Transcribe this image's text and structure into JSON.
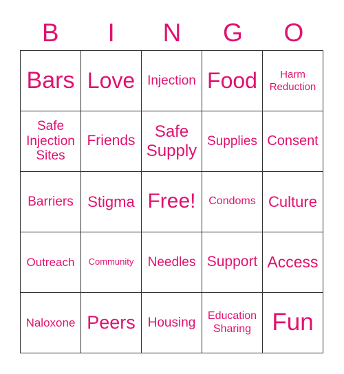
{
  "header": [
    "B",
    "I",
    "N",
    "G",
    "O"
  ],
  "accent_color": "#e0126f",
  "cells": [
    [
      {
        "text": "Bars",
        "size": 34
      },
      {
        "text": "Love",
        "size": 32
      },
      {
        "text": "Injection",
        "size": 19
      },
      {
        "text": "Food",
        "size": 32
      },
      {
        "text": "Harm Reduction",
        "size": 15
      }
    ],
    [
      {
        "text": "Safe Injection Sites",
        "size": 19
      },
      {
        "text": "Friends",
        "size": 21
      },
      {
        "text": "Safe Supply",
        "size": 24
      },
      {
        "text": "Supplies",
        "size": 19
      },
      {
        "text": "Consent",
        "size": 20
      }
    ],
    [
      {
        "text": "Barriers",
        "size": 19
      },
      {
        "text": "Stigma",
        "size": 22
      },
      {
        "text": "Free!",
        "size": 30
      },
      {
        "text": "Condoms",
        "size": 16
      },
      {
        "text": "Culture",
        "size": 22
      }
    ],
    [
      {
        "text": "Outreach",
        "size": 17
      },
      {
        "text": "Community",
        "size": 13
      },
      {
        "text": "Needles",
        "size": 19
      },
      {
        "text": "Support",
        "size": 21
      },
      {
        "text": "Access",
        "size": 23
      }
    ],
    [
      {
        "text": "Naloxone",
        "size": 17
      },
      {
        "text": "Peers",
        "size": 27
      },
      {
        "text": "Housing",
        "size": 19
      },
      {
        "text": "Education Sharing",
        "size": 16
      },
      {
        "text": "Fun",
        "size": 35
      }
    ]
  ]
}
